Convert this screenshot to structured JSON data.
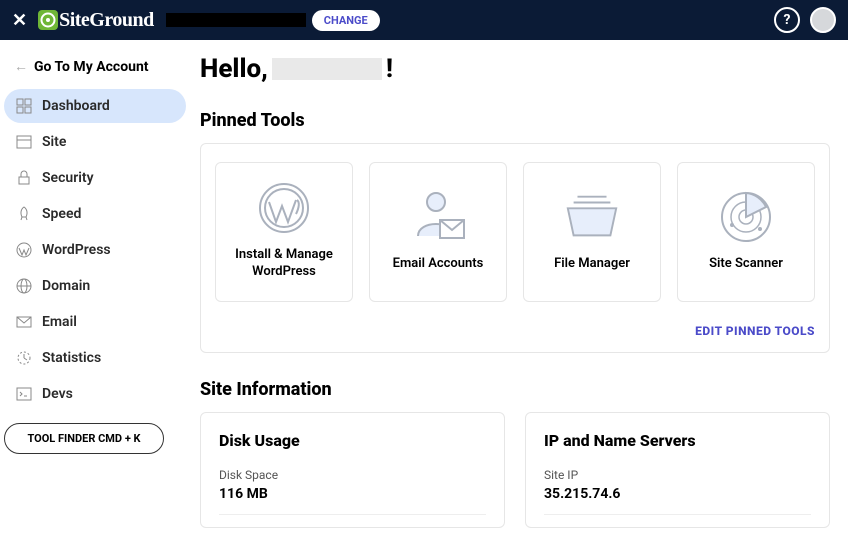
{
  "header": {
    "logo_text": "SiteGround",
    "change_label": "CHANGE"
  },
  "sidebar": {
    "back_label": "Go To My Account",
    "items": [
      {
        "label": "Dashboard",
        "active": true
      },
      {
        "label": "Site"
      },
      {
        "label": "Security"
      },
      {
        "label": "Speed"
      },
      {
        "label": "WordPress"
      },
      {
        "label": "Domain"
      },
      {
        "label": "Email"
      },
      {
        "label": "Statistics"
      },
      {
        "label": "Devs"
      }
    ],
    "tool_finder_label": "TOOL FINDER CMD + K"
  },
  "main": {
    "hello_prefix": "Hello,",
    "hello_suffix": "!",
    "pinned_title": "Pinned Tools",
    "pinned_tools": [
      {
        "label": "Install & Manage WordPress"
      },
      {
        "label": "Email Accounts"
      },
      {
        "label": "File Manager"
      },
      {
        "label": "Site Scanner"
      }
    ],
    "edit_pinned_label": "EDIT PINNED TOOLS",
    "site_info_title": "Site Information",
    "disk": {
      "title": "Disk Usage",
      "label": "Disk Space",
      "value": "116 MB"
    },
    "ipns": {
      "title": "IP and Name Servers",
      "label": "Site IP",
      "value": "35.215.74.6"
    }
  }
}
